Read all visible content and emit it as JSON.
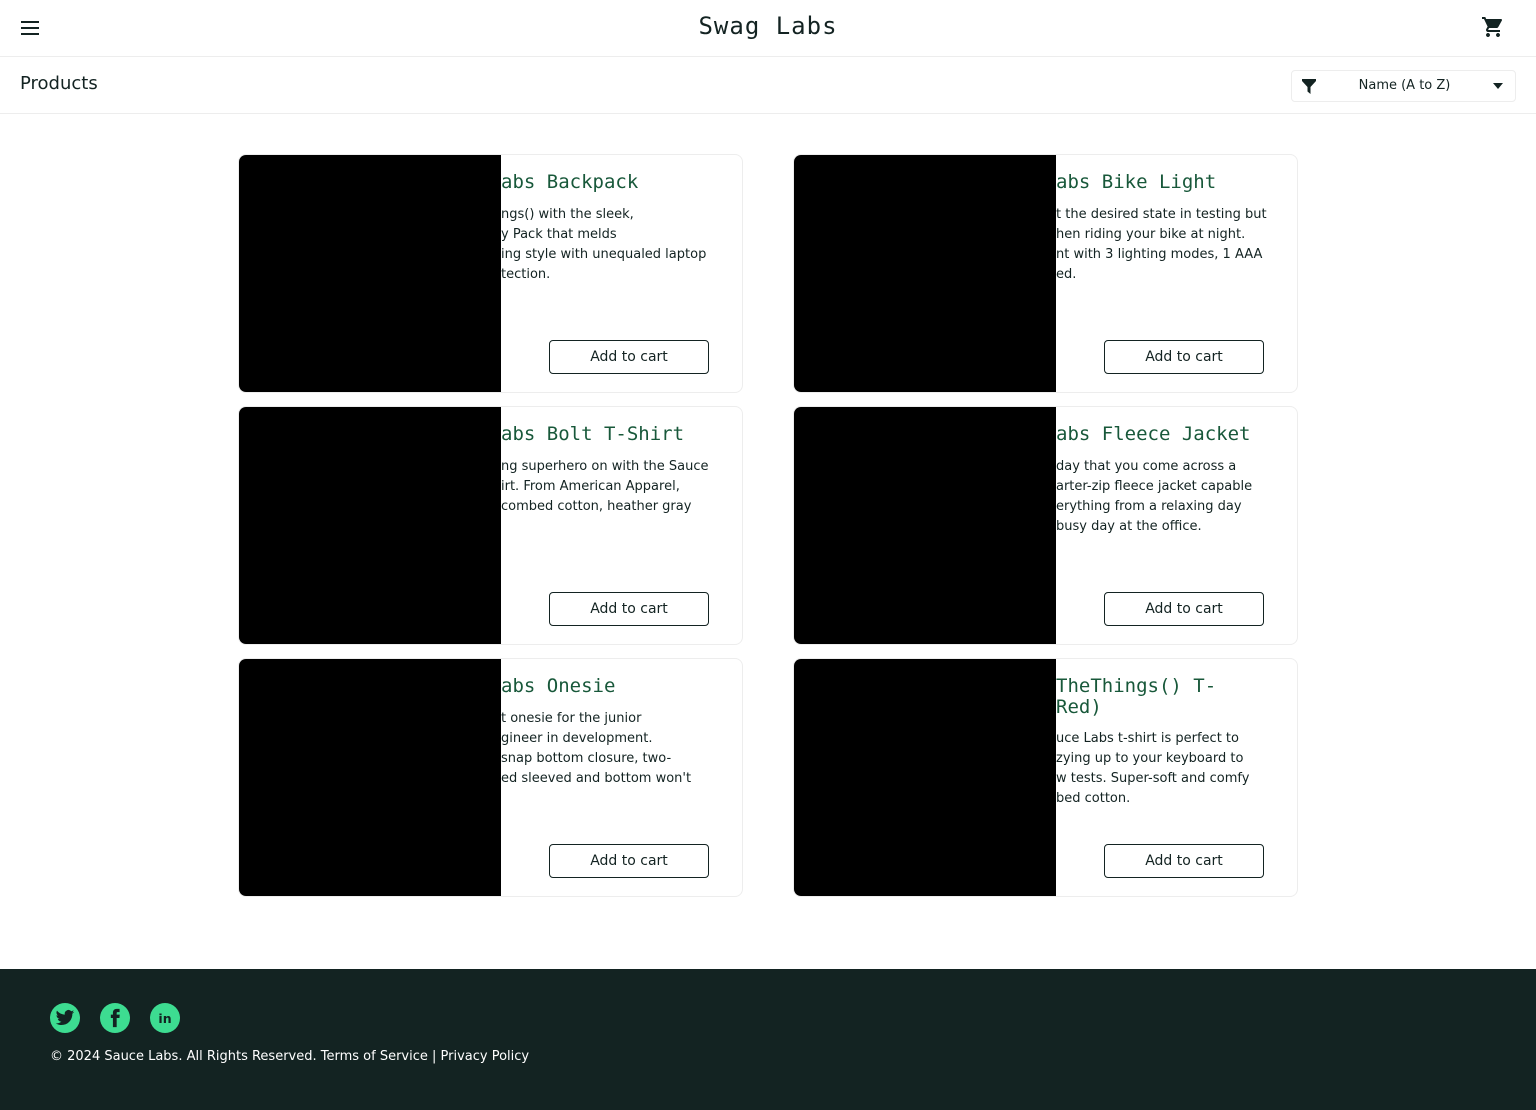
{
  "header": {
    "app_title": "Swag Labs",
    "menu_icon": "hamburger-icon",
    "cart_icon": "shopping-cart-icon"
  },
  "sub_header": {
    "title": "Products",
    "sort": {
      "icon": "filter-icon",
      "selected": "Name (A to Z)"
    }
  },
  "items": [
    {
      "name": "abs Backpack",
      "description": "ngs() with the sleek,\ny Pack that melds\ning style with unequaled laptop\ntection.",
      "button": "Add to cart"
    },
    {
      "name": "abs Bike Light",
      "description": "t the desired state in testing but\nhen riding your bike at night.\nnt with 3 lighting modes, 1 AAA\ned.",
      "button": "Add to cart"
    },
    {
      "name": "abs Bolt T-Shirt",
      "description": "ng superhero on with the Sauce\nirt. From American Apparel,\n combed cotton, heather gray",
      "button": "Add to cart"
    },
    {
      "name": "abs Fleece Jacket",
      "description": "day that you come across a\narter-zip fleece jacket capable\nerything from a relaxing day\nbusy day at the office.",
      "button": "Add to cart"
    },
    {
      "name": "abs Onesie",
      "description": "t onesie for the junior\ngineer in development.\nsnap bottom closure, two-\ned sleeved and bottom won't",
      "button": "Add to cart"
    },
    {
      "name": "TheThings() T-\nRed)",
      "description": "uce Labs t-shirt is perfect to\nzying up to your keyboard to\nw tests. Super-soft and comfy\nbed cotton.",
      "button": "Add to cart"
    }
  ],
  "footer": {
    "social": [
      "twitter-icon",
      "facebook-icon",
      "linkedin-icon"
    ],
    "copyright": "© 2024 Sauce Labs. All Rights Reserved. Terms of Service | Privacy Policy"
  },
  "colors": {
    "brand_text": "#132322",
    "item_name": "#18583a",
    "footer_bg": "#132322",
    "social_bg": "#3ddc91"
  }
}
